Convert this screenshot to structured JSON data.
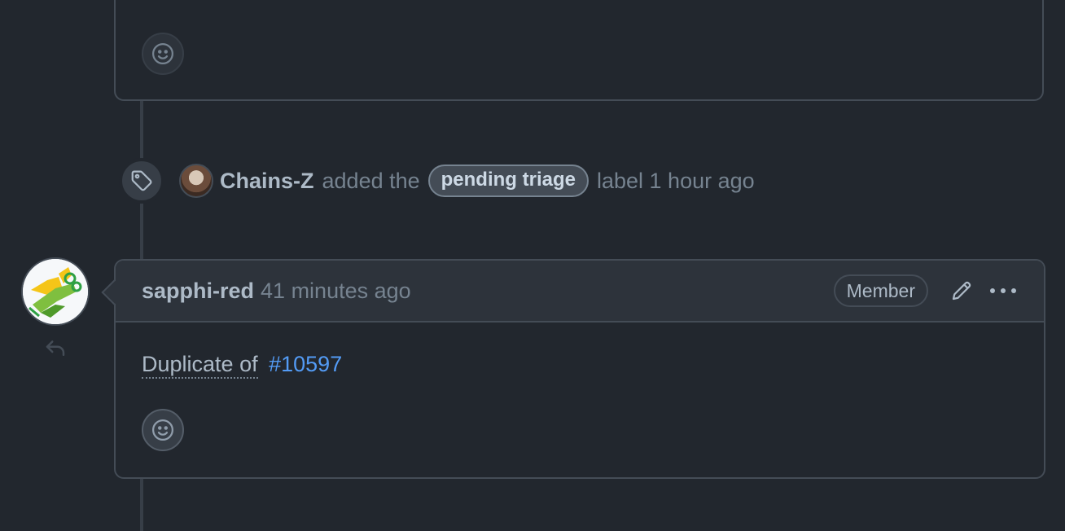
{
  "label_event": {
    "author": "Chains-Z",
    "verb": "added the",
    "label": "pending triage",
    "suffix": "label 1 hour ago"
  },
  "comment": {
    "author": "sapphi-red",
    "time": "41 minutes ago",
    "role_badge": "Member",
    "body_prefix": "Duplicate of",
    "issue_ref": "#10597"
  },
  "icons": {
    "reaction": "smiley-icon",
    "label_event": "tag-icon",
    "reply": "reply-icon",
    "edit": "pencil-icon",
    "more": "kebab-horizontal-icon"
  },
  "colors": {
    "background": "#22272e",
    "header": "#2d333b",
    "border": "#444c56",
    "link": "#539bf5",
    "muted": "#768390"
  }
}
